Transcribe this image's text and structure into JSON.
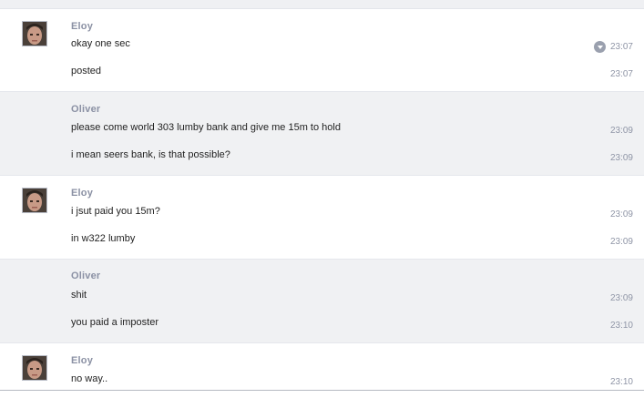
{
  "messages": [
    {
      "sender": "Eloy",
      "has_avatar": true,
      "lines": [
        {
          "text": "okay one sec",
          "time": "23:07",
          "icon": "chevron-down-icon"
        },
        {
          "text": "posted",
          "time": "23:07"
        }
      ]
    },
    {
      "sender": "Oliver",
      "has_avatar": false,
      "lines": [
        {
          "text": "please come world 303 lumby bank and give me 15m to hold",
          "time": "23:09"
        },
        {
          "text": "i mean seers bank, is that possible?",
          "time": "23:09"
        }
      ]
    },
    {
      "sender": "Eloy",
      "has_avatar": true,
      "lines": [
        {
          "text": "i jsut paid you 15m?",
          "time": "23:09"
        },
        {
          "text": "in w322 lumby",
          "time": "23:09"
        }
      ]
    },
    {
      "sender": "Oliver",
      "has_avatar": false,
      "lines": [
        {
          "text": "shit",
          "time": "23:09"
        },
        {
          "text": "you paid a imposter",
          "time": "23:10"
        }
      ]
    },
    {
      "sender": "Eloy",
      "has_avatar": true,
      "lines": [
        {
          "text": "no way..",
          "time": "23:10"
        }
      ]
    }
  ]
}
